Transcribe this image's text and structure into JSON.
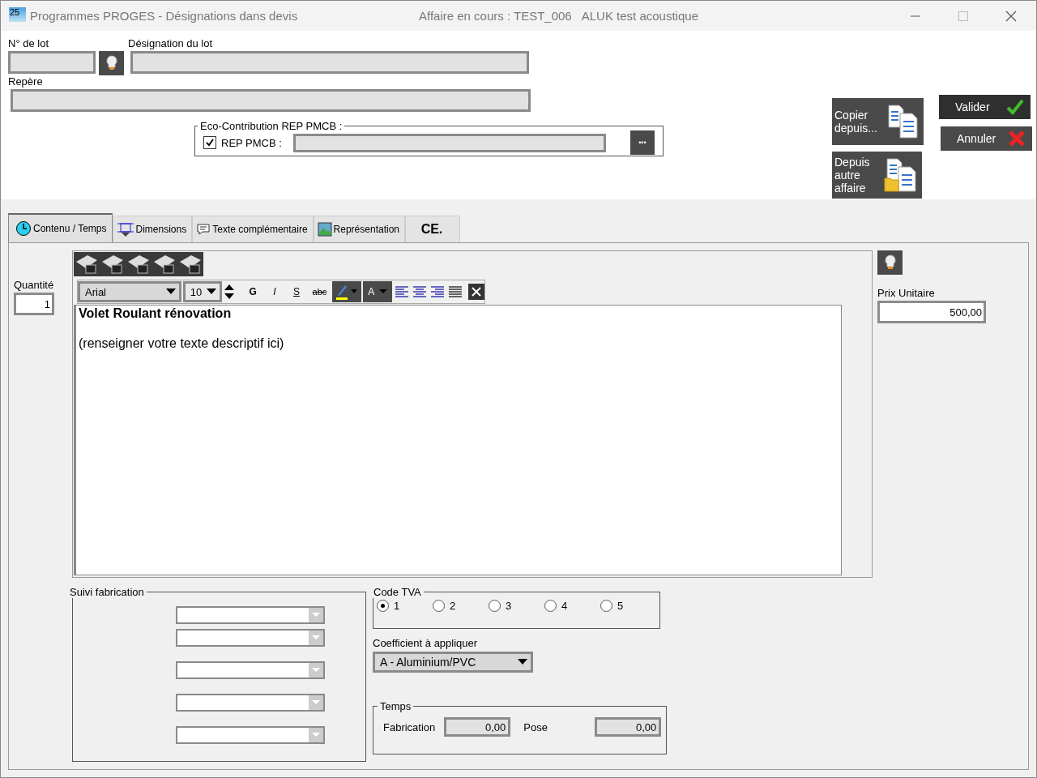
{
  "window": {
    "app_badge": "25",
    "title": "Programmes PROGES - Désignations dans devis",
    "affaire": "Affaire en cours : TEST_006",
    "affaire_name": "ALUK test acoustique"
  },
  "lot": {
    "number_label": "N° de lot",
    "designation_label": "Désignation du lot",
    "repere_label": "Repère"
  },
  "eco": {
    "legend": "Eco-Contribution REP PMCB :",
    "checkbox_label": "REP PMCB :",
    "checked": true,
    "more_label": "•••"
  },
  "actions": [
    {
      "label": "Copier depuis...",
      "kind": "copy"
    },
    {
      "label": "Depuis autre affaire",
      "kind": "folder"
    }
  ],
  "dialog_buttons": [
    {
      "label": "Valider",
      "kind": "ok"
    },
    {
      "label": "Annuler",
      "kind": "cancel"
    }
  ],
  "tabs": [
    {
      "label": "Contenu / Temps",
      "selected": true,
      "kind": "clock"
    },
    {
      "label": "Dimensions",
      "selected": false,
      "kind": "dimensions"
    },
    {
      "label": "Texte complémentaire",
      "selected": false,
      "kind": "speech"
    },
    {
      "label": "Représentation",
      "selected": false,
      "kind": "picture"
    },
    {
      "label": "CE.",
      "selected": false,
      "kind": "ce"
    }
  ],
  "quantity": {
    "label": "Quantité",
    "value": "1"
  },
  "editor": {
    "font": "Arial",
    "size": "10",
    "bold_label": "G",
    "italic_label": "I",
    "underline_label": "S",
    "strike_label": "abc",
    "color_label": "A",
    "title": "Volet Roulant rénovation",
    "body": "(renseigner votre texte descriptif ici)"
  },
  "price": {
    "label": "Prix Unitaire",
    "value": "500,00"
  },
  "suivi": {
    "legend": "Suivi fabrication"
  },
  "tva": {
    "legend": "Code TVA",
    "options": [
      {
        "label": "1",
        "selected": true
      },
      {
        "label": "2",
        "selected": false
      },
      {
        "label": "3",
        "selected": false
      },
      {
        "label": "4",
        "selected": false
      },
      {
        "label": "5",
        "selected": false
      }
    ]
  },
  "coefficient": {
    "label": "Coefficient à appliquer",
    "value": "A - Aluminium/PVC"
  },
  "temps": {
    "legend": "Temps",
    "fields": [
      {
        "label": "Fabrication",
        "value": "0,00"
      },
      {
        "label": "Pose",
        "value": "0,00"
      }
    ]
  }
}
